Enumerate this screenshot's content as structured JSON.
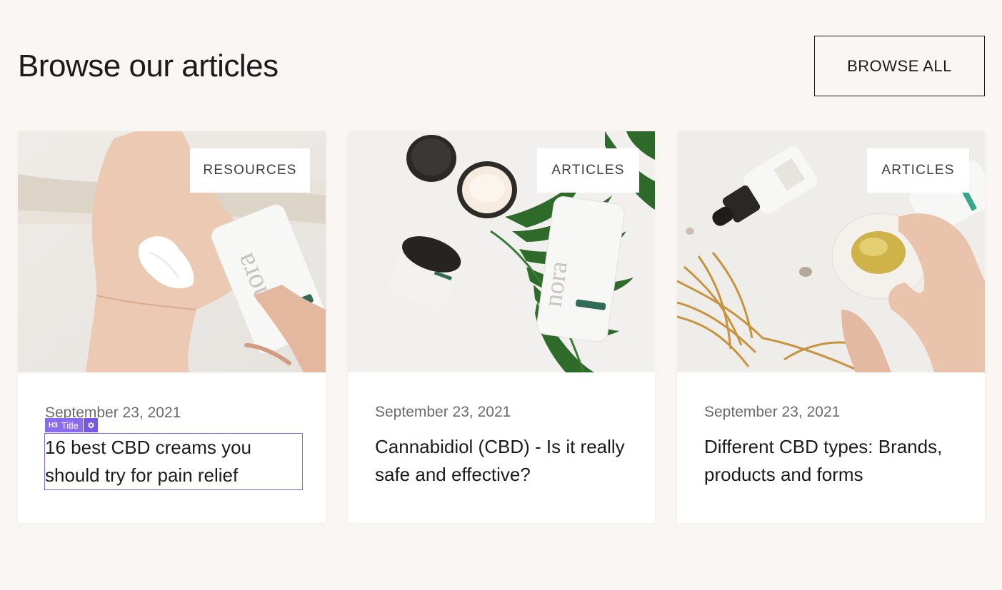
{
  "header": {
    "title": "Browse our articles",
    "browse_all_label": "BROWSE ALL"
  },
  "editor_overlay": {
    "tag": "H3",
    "label": "Title",
    "icon": "gear-icon",
    "accent": "#8a6cf0"
  },
  "articles": [
    {
      "category": "RESOURCES",
      "date": "September 23, 2021",
      "title": "16 best CBD creams you should try for pain relief",
      "image": "hand-applying-cream-photo"
    },
    {
      "category": "ARTICLES",
      "date": "September 23, 2021",
      "title": "Cannabidiol (CBD) - Is it really safe and effective?",
      "image": "cbd-products-with-leaves-photo"
    },
    {
      "category": "ARTICLES",
      "date": "September 23, 2021",
      "title": "Different CBD types: Brands, products and forms",
      "image": "cbd-oil-dish-photo"
    }
  ],
  "colors": {
    "background": "#f9f6f3",
    "card": "#ffffff",
    "text": "#1b1b1b",
    "muted": "#6b6b6b"
  }
}
